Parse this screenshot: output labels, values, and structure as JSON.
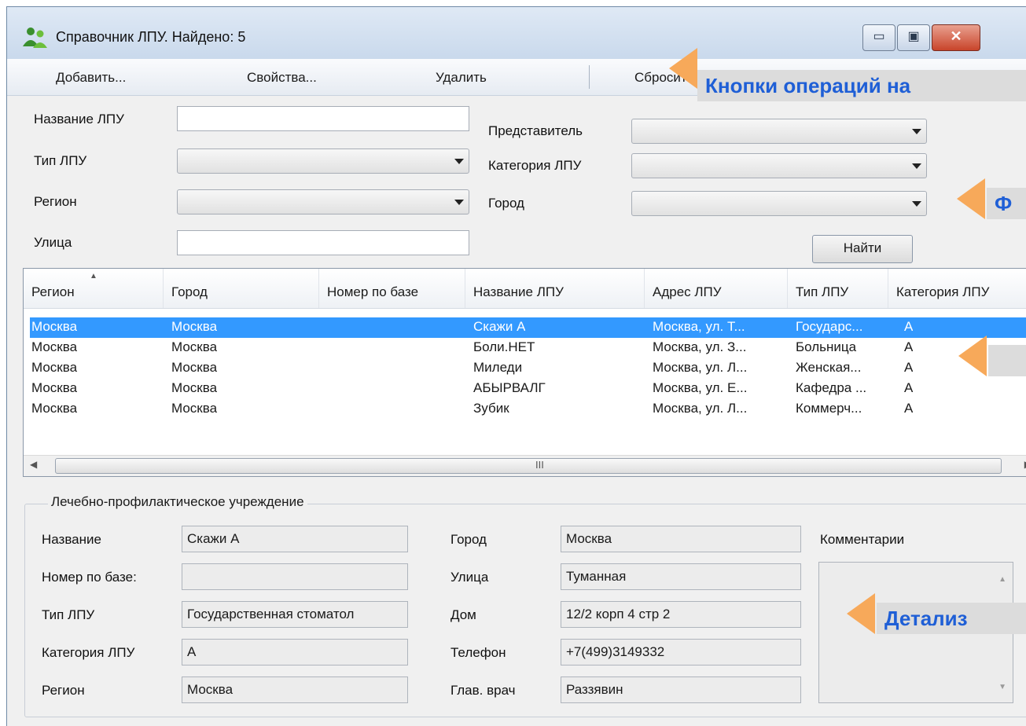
{
  "window": {
    "title": "Справочник ЛПУ. Найдено: 5",
    "min_glyph": "▭",
    "max_glyph": "▣",
    "close_glyph": "✕"
  },
  "toolbar": {
    "add": "Добавить...",
    "properties": "Свойства...",
    "delete": "Удалить",
    "reset": "Сбросить фильтр"
  },
  "callouts": {
    "ops": "Кнопки операций на",
    "filter": "Ф",
    "detail": "Детализ"
  },
  "filter": {
    "name_label": "Название ЛПУ",
    "name_value": "",
    "type_label": "Тип ЛПУ",
    "region_label": "Регион",
    "street_label": "Улица",
    "street_value": "",
    "rep_label": "Представитель",
    "category_label": "Категория ЛПУ",
    "city_label": "Город",
    "find": "Найти"
  },
  "grid": {
    "columns": [
      "Регион",
      "Город",
      "Номер по базе",
      "Название ЛПУ",
      "Адрес ЛПУ",
      "Тип ЛПУ",
      "Категория ЛПУ"
    ],
    "rows": [
      [
        "Москва",
        "Москва",
        "",
        "Скажи А",
        "Москва, ул. Т...",
        "Государс...",
        "А"
      ],
      [
        "Москва",
        "Москва",
        "",
        "Боли.НЕТ",
        "Москва, ул. З...",
        "Больница",
        "А"
      ],
      [
        "Москва",
        "Москва",
        "",
        "Миледи",
        "Москва, ул. Л...",
        "Женская...",
        "А"
      ],
      [
        "Москва",
        "Москва",
        "",
        "АБЫРВАЛГ",
        "Москва, ул. Е...",
        "Кафедра ...",
        "А"
      ],
      [
        "Москва",
        "Москва",
        "",
        "Зубик",
        "Москва, ул. Л...",
        "Коммерч...",
        "А"
      ]
    ],
    "scroll_grip": "III"
  },
  "detail": {
    "group_title": "Лечебно-профилактическое учреждение",
    "name_label": "Название",
    "name_value": "Скажи А",
    "number_label": "Номер по базе:",
    "number_value": "",
    "type_label": "Тип ЛПУ",
    "type_value": "Государственная стоматол",
    "category_label": "Категория ЛПУ",
    "category_value": "А",
    "region_label": "Регион",
    "region_value": "Москва",
    "city_label": "Город",
    "city_value": "Москва",
    "street_label": "Улица",
    "street_value": "Туманная",
    "house_label": "Дом",
    "house_value": "12/2 корп 4 стр 2",
    "phone_label": "Телефон",
    "phone_value": "+7(499)3149332",
    "doctor_label": "Глав. врач",
    "doctor_value": "Раззявин",
    "comments_label": "Комментарии"
  }
}
